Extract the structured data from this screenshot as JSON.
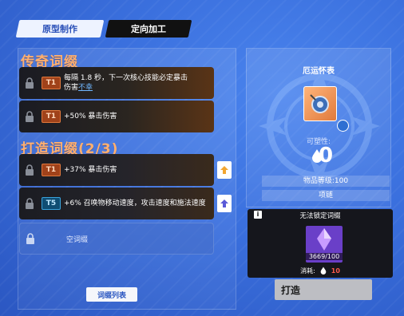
{
  "tabs": [
    {
      "label": "原型制作"
    },
    {
      "label": "定向加工"
    }
  ],
  "left": {
    "legend_title": "传奇词缀",
    "legend_rows": [
      {
        "tier": "T1",
        "text_a": "每隔 1.8 秒，下一次核心技能必定暴击",
        "text_b": "伤害",
        "highlight": "不幸"
      },
      {
        "tier": "T1",
        "text": "+50% 暴击伤害"
      }
    ],
    "forge_title": "打造词缀(2/3)",
    "forge_rows": [
      {
        "tier": "T1",
        "text": "+37% 暴击伤害"
      },
      {
        "tier": "T5",
        "text": "+6% 召唤物移动速度，攻击速度和施法速度"
      },
      {
        "text": "空词缀"
      }
    ],
    "list_button": "词缀列表"
  },
  "right": {
    "item_name": "厄运怀表",
    "plasticity_label": "可塑性:",
    "plasticity_value": "0",
    "item_level": "物品等级:100",
    "item_slot": "项链",
    "lock_title": "无法锁定词缀",
    "info_icon": "i",
    "material_count": "3669/100",
    "cost_label": "消耗:",
    "cost_value": "10",
    "forge_button": "打造"
  },
  "colors": {
    "background": "#3a6fdd",
    "legend_title": "#ffb070",
    "highlight": "#6fb6ff",
    "cost": "#ff5a4a"
  }
}
